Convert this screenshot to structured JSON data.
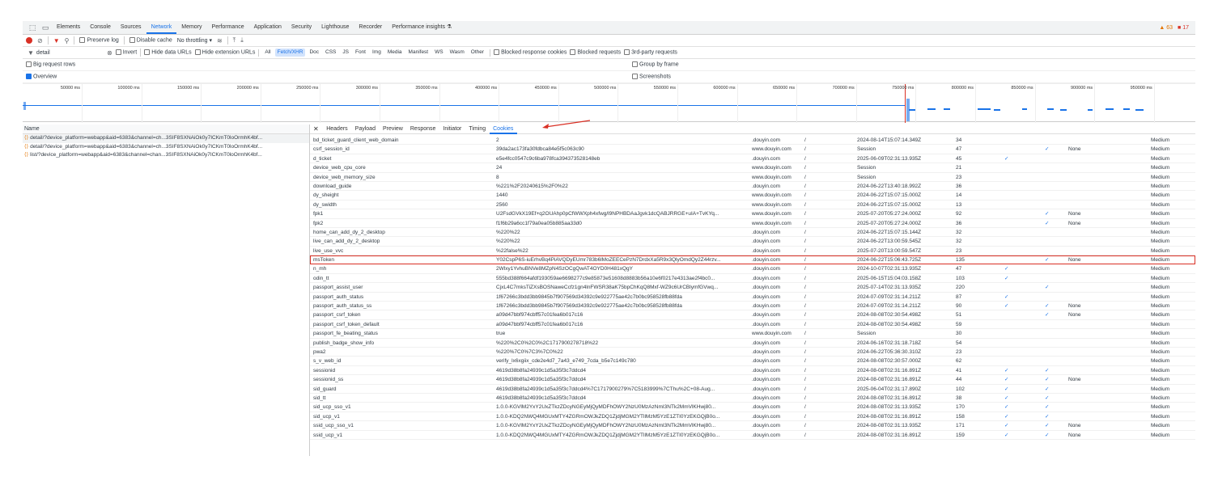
{
  "devtools": {
    "panels": [
      "Elements",
      "Console",
      "Sources",
      "Network",
      "Memory",
      "Performance",
      "Application",
      "Security",
      "Lighthouse",
      "Recorder",
      "Performance insights ⚗"
    ],
    "active_panel": "Network",
    "warnings": "▲ 63",
    "errors": "■ 17"
  },
  "toolbar": {
    "preserve_log": "Preserve log",
    "disable_cache": "Disable cache",
    "throttling": "No throttling"
  },
  "filter": {
    "value": "detail",
    "invert": "Invert",
    "hide_data_urls": "Hide data URLs",
    "hide_ext_urls": "Hide extension URLs",
    "types": [
      "All",
      "Fetch/XHR",
      "Doc",
      "CSS",
      "JS",
      "Font",
      "Img",
      "Media",
      "Manifest",
      "WS",
      "Wasm",
      "Other"
    ],
    "active_type": "Fetch/XHR",
    "blocked_cookies": "Blocked response cookies",
    "blocked_requests": "Blocked requests",
    "third_party": "3rd-party requests"
  },
  "options": {
    "big_rows": "Big request rows",
    "overview": "Overview",
    "group_by_frame": "Group by frame",
    "screenshots": "Screenshots"
  },
  "timeline": {
    "ticks": [
      "50000 ms",
      "100000 ms",
      "150000 ms",
      "200000 ms",
      "250000 ms",
      "300000 ms",
      "350000 ms",
      "400000 ms",
      "450000 ms",
      "500000 ms",
      "550000 ms",
      "600000 ms",
      "650000 ms",
      "700000 ms",
      "750000 ms",
      "800000 ms",
      "850000 ms",
      "900000 ms",
      "950000 ms",
      "100"
    ]
  },
  "requests": {
    "header": "Name",
    "items": [
      "detail/?device_platform=webapp&aid=6383&channel=ch...3SIF8SXNAiOk0y7ICKmT0loOrmhK4bf...",
      "detail/?device_platform=webapp&aid=6383&channel=ch...3SIF8SXNAiOk0y7ICKmT0loOrmhK4bf...",
      "list/?device_platform=webapp&aid=6383&channel=chan...3SIF8SXNAiOk0y7ICKmT0loOrmhK4bf..."
    ]
  },
  "details": {
    "close": "✕",
    "tabs": [
      "Headers",
      "Payload",
      "Preview",
      "Response",
      "Initiator",
      "Timing",
      "Cookies"
    ],
    "active_tab": "Cookies"
  },
  "cookies": [
    {
      "n": "bd_ticket_guard_client_web_domain",
      "v": "2",
      "d": ".douyin.com",
      "p": "/",
      "e": "2024-08-14T15:07:14.349Z",
      "s": "34",
      "h": "",
      "sec": "",
      "ss": "",
      "pr": "Medium"
    },
    {
      "n": "csrf_session_id",
      "v": "39da2ac173fa30fdbca84e5f5c063c90",
      "d": "www.douyin.com",
      "p": "/",
      "e": "Session",
      "s": "47",
      "h": "",
      "sec": "✓",
      "ss": "None",
      "pr": "Medium"
    },
    {
      "n": "d_ticket",
      "v": "e5e4fcc0547c9c6ba978fca394373528148eb",
      "d": ".douyin.com",
      "p": "/",
      "e": "2025-06-09T02:31:13.935Z",
      "s": "45",
      "h": "✓",
      "sec": "",
      "ss": "",
      "pr": "Medium"
    },
    {
      "n": "device_web_cpu_core",
      "v": "24",
      "d": "www.douyin.com",
      "p": "/",
      "e": "Session",
      "s": "21",
      "h": "",
      "sec": "",
      "ss": "",
      "pr": "Medium"
    },
    {
      "n": "device_web_memory_size",
      "v": "8",
      "d": "www.douyin.com",
      "p": "/",
      "e": "Session",
      "s": "23",
      "h": "",
      "sec": "",
      "ss": "",
      "pr": "Medium"
    },
    {
      "n": "download_guide",
      "v": "%221%2F20240615%2F0%22",
      "d": ".douyin.com",
      "p": "/",
      "e": "2024-06-22T13:40:18.992Z",
      "s": "36",
      "h": "",
      "sec": "",
      "ss": "",
      "pr": "Medium"
    },
    {
      "n": "dy_sheight",
      "v": "1440",
      "d": "www.douyin.com",
      "p": "/",
      "e": "2024-06-22T15:07:15.000Z",
      "s": "14",
      "h": "",
      "sec": "",
      "ss": "",
      "pr": "Medium"
    },
    {
      "n": "dy_swidth",
      "v": "2560",
      "d": "www.douyin.com",
      "p": "/",
      "e": "2024-06-22T15:07:15.000Z",
      "s": "13",
      "h": "",
      "sec": "",
      "ss": "",
      "pr": "Medium"
    },
    {
      "n": "fpk1",
      "v": "U2FsdGVkX19Ef+q2OUAhp0pCfWWXph4xfwg/l9NPHBDAaJgvk1dcQABJRRGE+uIA+TvKYq...",
      "d": "www.douyin.com",
      "p": "/",
      "e": "2025-07-20T05:27:24.000Z",
      "s": "92",
      "h": "",
      "sec": "✓",
      "ss": "None",
      "pr": "Medium"
    },
    {
      "n": "fpk2",
      "v": "f1f6b29a6cc1f79a0ea05b885aa33d0",
      "d": "www.douyin.com",
      "p": "/",
      "e": "2025-07-20T05:27:24.000Z",
      "s": "36",
      "h": "",
      "sec": "✓",
      "ss": "None",
      "pr": "Medium"
    },
    {
      "n": "home_can_add_dy_2_desktop",
      "v": "%220%22",
      "d": ".douyin.com",
      "p": "/",
      "e": "2024-06-22T15:07:15.144Z",
      "s": "32",
      "h": "",
      "sec": "",
      "ss": "",
      "pr": "Medium"
    },
    {
      "n": "live_can_add_dy_2_desktop",
      "v": "%220%22",
      "d": ".douyin.com",
      "p": "/",
      "e": "2024-06-22T13:00:59.545Z",
      "s": "32",
      "h": "",
      "sec": "",
      "ss": "",
      "pr": "Medium"
    },
    {
      "n": "live_use_vvc",
      "v": "%22false%22",
      "d": ".douyin.com",
      "p": "/",
      "e": "2025-07-20T13:00:59.547Z",
      "s": "23",
      "h": "",
      "sec": "",
      "ss": "",
      "pr": "Medium"
    },
    {
      "n": "msToken",
      "v": "Y02CspP6S-iuErhvBq4PiAVQDyEUmr783b6lMoZEECePzN7DrdxXa5R9x3QlyOmdQy2Z44rzv...",
      "d": ".douyin.com",
      "p": "/",
      "e": "2024-06-22T15:06:43.725Z",
      "s": "135",
      "h": "",
      "sec": "✓",
      "ss": "None",
      "pr": "Medium",
      "hl": true
    },
    {
      "n": "n_mh",
      "v": "2Wlxy1YvhuBNVe8MZpN4SzOCgQwAT4OYD0H481xQgY",
      "d": ".douyin.com",
      "p": "/",
      "e": "2024-10-07T02:31:13.935Z",
      "s": "47",
      "h": "✓",
      "sec": "",
      "ss": "",
      "pr": "Medium"
    },
    {
      "n": "odin_tt",
      "v": "555bd388f664afdf193059ae6698277c9e85873e51608d8883b56a10e6f0217e4313ae2f4bc0...",
      "d": ".douyin.com",
      "p": "/",
      "e": "2025-06-15T15:04:03.158Z",
      "s": "103",
      "h": "✓",
      "sec": "",
      "ss": "",
      "pr": "Medium"
    },
    {
      "n": "passport_assist_user",
      "v": "CjxL4C7mksTiZXsBOSNaweCcfz1gn4lnFWSR38aK75bpChKqQ8Mxf-WZ9c6UrCBlymfGVwq...",
      "d": ".douyin.com",
      "p": "/",
      "e": "2025-07-14T02:31:13.935Z",
      "s": "220",
      "h": "",
      "sec": "✓",
      "ss": "",
      "pr": "Medium"
    },
    {
      "n": "passport_auth_status",
      "v": "1f67266c3bdd3bb9845b7f907569d34392c9e922775ae42c7b0bc958528fb88fda",
      "d": ".douyin.com",
      "p": "/",
      "e": "2024-07-09T02:31:14.211Z",
      "s": "87",
      "h": "✓",
      "sec": "",
      "ss": "",
      "pr": "Medium"
    },
    {
      "n": "passport_auth_status_ss",
      "v": "1f67266c3bdd3bb9845b7f907569d34392c9e922775ae42c7b0bc958528fb88fda",
      "d": ".douyin.com",
      "p": "/",
      "e": "2024-07-09T02:31:14.211Z",
      "s": "90",
      "h": "✓",
      "sec": "✓",
      "ss": "None",
      "pr": "Medium"
    },
    {
      "n": "passport_csrf_token",
      "v": "a09d47bbf974cbff57c01fea6b017c16",
      "d": ".douyin.com",
      "p": "/",
      "e": "2024-08-08T02:30:54.498Z",
      "s": "51",
      "h": "",
      "sec": "✓",
      "ss": "None",
      "pr": "Medium"
    },
    {
      "n": "passport_csrf_token_default",
      "v": "a09d47bbf974cbff57c01fea6b017c16",
      "d": ".douyin.com",
      "p": "/",
      "e": "2024-08-08T02:30:54.498Z",
      "s": "59",
      "h": "",
      "sec": "",
      "ss": "",
      "pr": "Medium"
    },
    {
      "n": "passport_fe_beating_status",
      "v": "true",
      "d": "www.douyin.com",
      "p": "/",
      "e": "Session",
      "s": "30",
      "h": "",
      "sec": "",
      "ss": "",
      "pr": "Medium"
    },
    {
      "n": "publish_badge_show_info",
      "v": "%220%2C0%2C0%2C1717900278718%22",
      "d": ".douyin.com",
      "p": "/",
      "e": "2024-06-16T02:31:18.718Z",
      "s": "54",
      "h": "",
      "sec": "",
      "ss": "",
      "pr": "Medium"
    },
    {
      "n": "pwa2",
      "v": "%220%7C0%7C3%7C0%22",
      "d": ".douyin.com",
      "p": "/",
      "e": "2024-06-22T05:36:30.310Z",
      "s": "23",
      "h": "",
      "sec": "",
      "ss": "",
      "pr": "Medium"
    },
    {
      "n": "s_v_web_id",
      "v": "verify_lx6xgiix_cde2e4d7_7a43_e749_7cda_b5e7c149c780",
      "d": ".douyin.com",
      "p": "/",
      "e": "2024-08-08T02:30:57.000Z",
      "s": "62",
      "h": "",
      "sec": "",
      "ss": "",
      "pr": "Medium"
    },
    {
      "n": "sessionid",
      "v": "4619d38b8fa24939c1d5a35f3c7ddcd4",
      "d": ".douyin.com",
      "p": "/",
      "e": "2024-08-08T02:31:16.891Z",
      "s": "41",
      "h": "✓",
      "sec": "✓",
      "ss": "",
      "pr": "Medium"
    },
    {
      "n": "sessionid_ss",
      "v": "4619d38b8fa24939c1d5a35f3c7ddcd4",
      "d": ".douyin.com",
      "p": "/",
      "e": "2024-08-08T02:31:16.891Z",
      "s": "44",
      "h": "✓",
      "sec": "✓",
      "ss": "None",
      "pr": "Medium"
    },
    {
      "n": "sid_guard",
      "v": "4619d38b8fa24939c1d5a35f3c7ddcd4%7C1717900279%7C5183999%7CThu%2C+08-Aug...",
      "d": ".douyin.com",
      "p": "/",
      "e": "2025-06-04T02:31:17.890Z",
      "s": "102",
      "h": "✓",
      "sec": "✓",
      "ss": "",
      "pr": "Medium"
    },
    {
      "n": "sid_tt",
      "v": "4619d38b8fa24939c1d5a35f3c7ddcd4",
      "d": ".douyin.com",
      "p": "/",
      "e": "2024-08-08T02:31:16.891Z",
      "s": "38",
      "h": "✓",
      "sec": "✓",
      "ss": "",
      "pr": "Medium"
    },
    {
      "n": "sid_ucp_sso_v1",
      "v": "1.0.0-KGVlM2YxY2UxZTkzZDcyNGEyMjQyMDFhOWY2NzU0MzAzNmI3NTk2MmVlKHwj80...",
      "d": ".douyin.com",
      "p": "/",
      "e": "2024-08-08T02:31:13.935Z",
      "s": "170",
      "h": "✓",
      "sec": "✓",
      "ss": "",
      "pr": "Medium"
    },
    {
      "n": "sid_ucp_v1",
      "v": "1.0.0-KDQ2NWQ4MGUxMTY4ZGRmOWJkZDQ1ZjdjMGM2YTllMzM5YzE1ZTI0YzEKGQjB0o...",
      "d": ".douyin.com",
      "p": "/",
      "e": "2024-08-08T02:31:16.891Z",
      "s": "158",
      "h": "✓",
      "sec": "✓",
      "ss": "",
      "pr": "Medium"
    },
    {
      "n": "ssid_ucp_sso_v1",
      "v": "1.0.0-KGVlM2YxY2UxZTkzZDcyNGEyMjQyMDFhOWY2NzU0MzAzNmI3NTk2MmVlKHwj80...",
      "d": ".douyin.com",
      "p": "/",
      "e": "2024-08-08T02:31:13.935Z",
      "s": "171",
      "h": "✓",
      "sec": "✓",
      "ss": "None",
      "pr": "Medium"
    },
    {
      "n": "ssid_ucp_v1",
      "v": "1.0.0-KDQ2NWQ4MGUxMTY4ZGRmOWJkZDQ1ZjdjMGM2YTllMzM5YzE1ZTI0YzEKGQjB0o...",
      "d": ".douyin.com",
      "p": "/",
      "e": "2024-08-08T02:31:16.891Z",
      "s": "159",
      "h": "✓",
      "sec": "✓",
      "ss": "None",
      "pr": "Medium"
    }
  ]
}
